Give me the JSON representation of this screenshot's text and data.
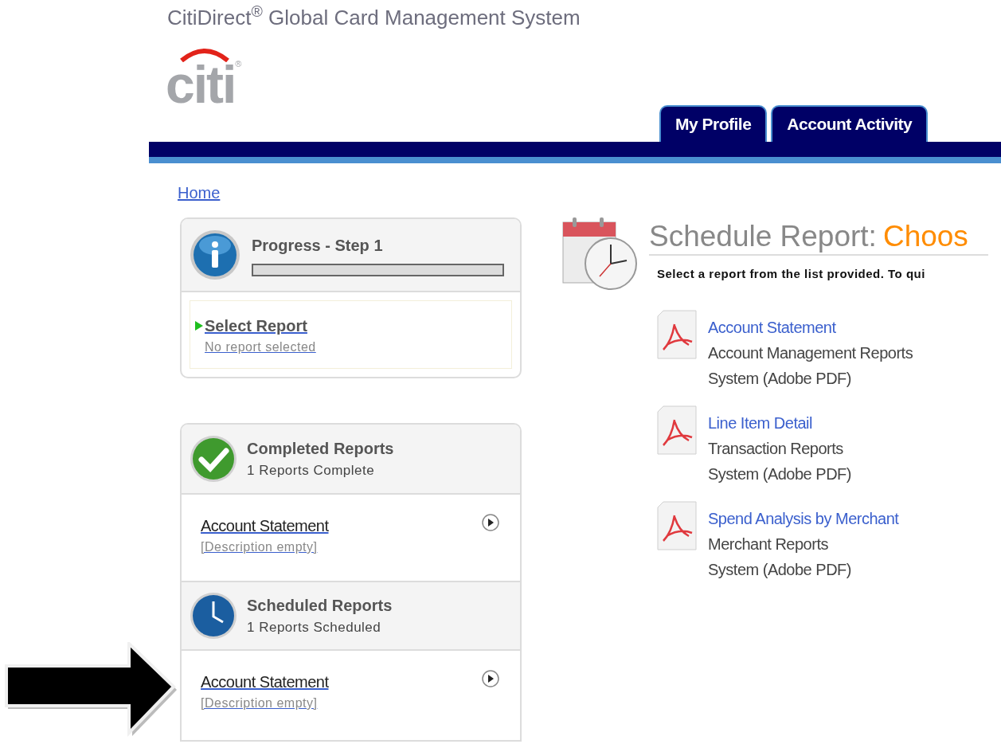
{
  "header": {
    "title": "CitiDirect$^{®}$ Global Card Management System",
    "logo": "citi",
    "logo_mark": "®"
  },
  "tabs": [
    {
      "label": "My Profile"
    },
    {
      "label": "Account Activity"
    }
  ],
  "breadcrumb": "Home",
  "progress": {
    "title": "Progress - Step 1",
    "level": 0,
    "steps": [
      {
        "label": "Select Report",
        "detail": "No report selected",
        "current": true
      }
    ]
  },
  "report_panels": [
    {
      "kind": "completed",
      "title": "Completed Reports",
      "count": "1 Reports Complete",
      "items": [
        {
          "name": "Account Statement",
          "description": "[Description empty]"
        }
      ]
    },
    {
      "kind": "scheduled",
      "title": "Scheduled Reports",
      "count": "1 Reports Scheduled",
      "items": [
        {
          "name": "Account Statement",
          "description": "[Description empty]"
        }
      ]
    }
  ],
  "main": {
    "title": "Schedule Report:",
    "title_highlight": "Choos",
    "instruction": "Select a report from the list provided. To qui",
    "reports": [
      {
        "name": "Account Statement",
        "category": "Account Management Reports",
        "source": "System (Adobe PDF)"
      },
      {
        "name": "Line Item Detail",
        "category": "Transaction Reports",
        "source": "System (Adobe PDF)"
      },
      {
        "name": "Spend Analysis by Merchant",
        "category": "Merchant Reports",
        "source": "System (Adobe PDF)"
      }
    ]
  },
  "annotation": {
    "kind": "arrow"
  }
}
